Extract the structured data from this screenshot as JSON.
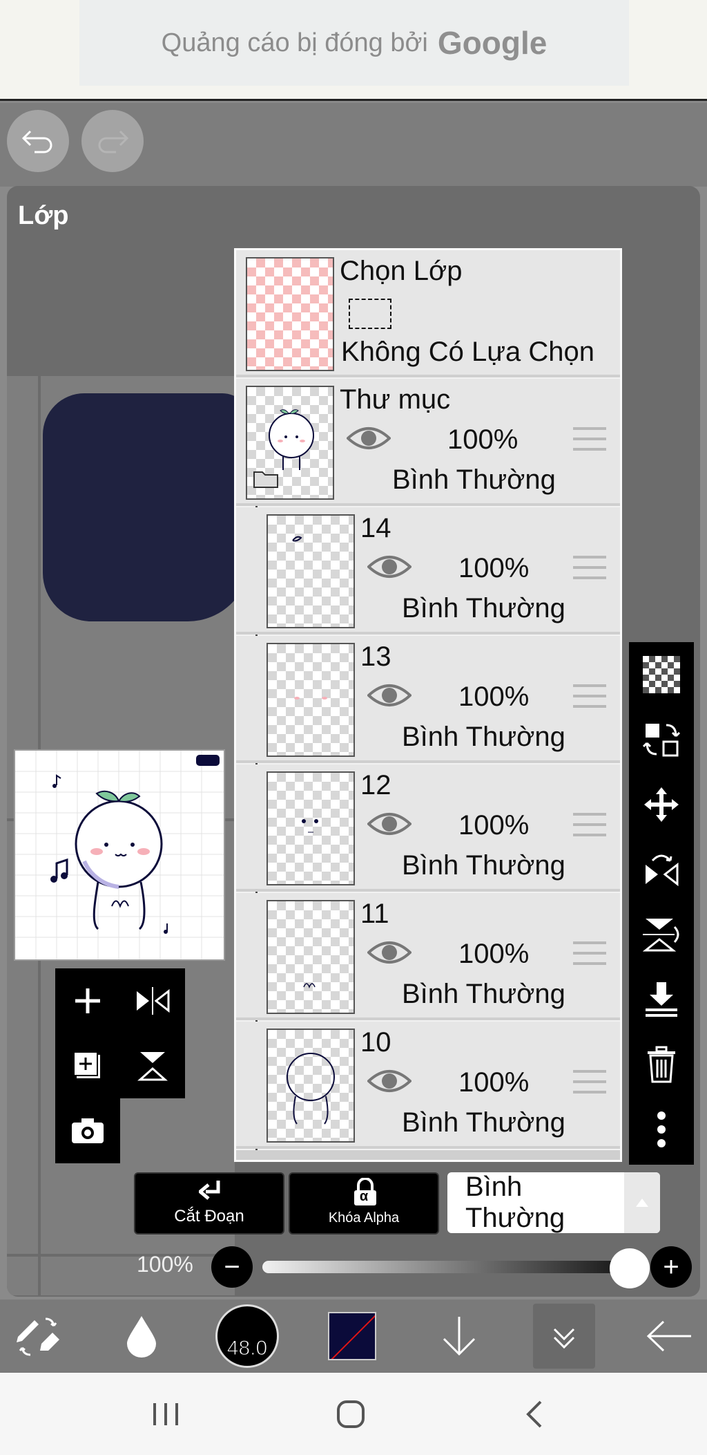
{
  "ad": {
    "text": "Quảng cáo bị đóng bởi",
    "brand": "Google"
  },
  "panel": {
    "title": "Lớp"
  },
  "selection_layer": {
    "title": "Chọn Lớp",
    "status": "Không Có Lựa Chọn"
  },
  "layers": [
    {
      "name": "Thư mục",
      "opacity": "100%",
      "mode": "Bình Thường",
      "icon": "folder-icon"
    },
    {
      "name": "14",
      "opacity": "100%",
      "mode": "Bình Thường"
    },
    {
      "name": "13",
      "opacity": "100%",
      "mode": "Bình Thường"
    },
    {
      "name": "12",
      "opacity": "100%",
      "mode": "Bình Thường"
    },
    {
      "name": "11",
      "opacity": "100%",
      "mode": "Bình Thường"
    },
    {
      "name": "10",
      "opacity": "100%",
      "mode": "Bình Thường"
    }
  ],
  "controls": {
    "clip_label": "Cắt Đoạn",
    "alpha_label": "Khóa Alpha",
    "alpha_symbol": "α",
    "blend_mode": "Bình Thường",
    "opacity_label": "100%",
    "opacity_value": 1.0,
    "minus": "−",
    "plus": "+"
  },
  "toolbar": {
    "brush_size": "48.0"
  },
  "colors": {
    "primary": "#0b0b3a",
    "panel": "#6c6c6c",
    "accent_pink": "#f6bcbc"
  },
  "icons": [
    "undo-icon",
    "redo-icon",
    "add-layer-icon",
    "flip-icon",
    "duplicate-icon",
    "camera-icon",
    "transparency-icon",
    "transform-icon",
    "move-icon",
    "rotate-icon",
    "flip-vertical-icon",
    "merge-down-icon",
    "trash-icon",
    "more-icon"
  ]
}
